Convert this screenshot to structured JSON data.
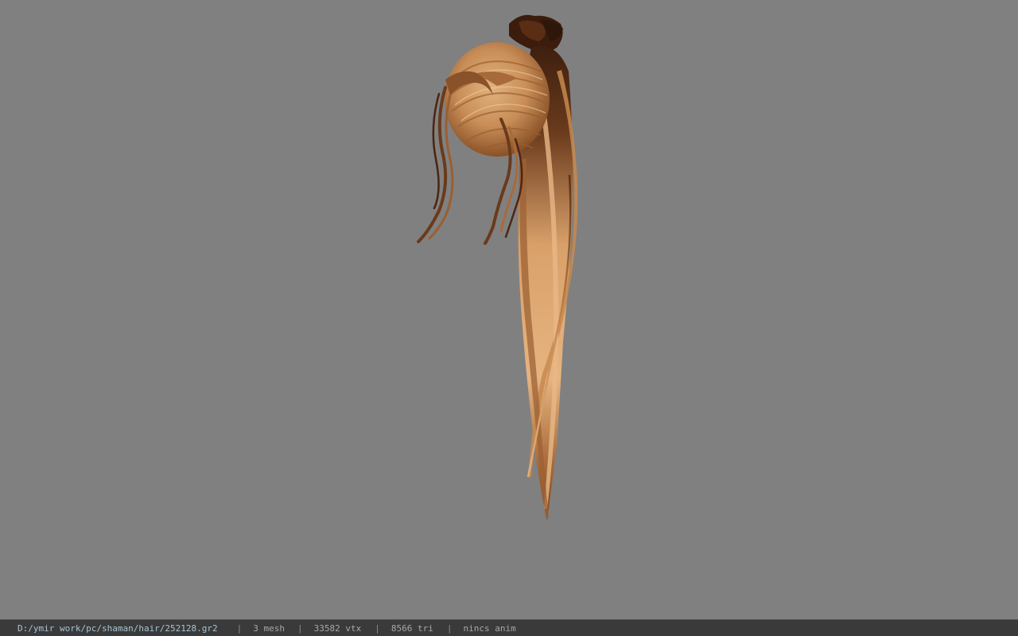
{
  "status_bar": {
    "file_path": "D:/ymir work/pc/shaman/hair/252128.gr2",
    "separator": "|",
    "mesh_count": "3 mesh",
    "vertex_count": "33582 vtx",
    "triangle_count": "8566 tri",
    "animation_status": "nincs anim"
  },
  "colors": {
    "viewport_background": "#808080",
    "status_bar_background": "#3a3a3a",
    "status_text": "#a8a8a8",
    "path_text": "#a9c3d4",
    "hair_dark": "#3e1f10",
    "hair_mid": "#a66a3c",
    "hair_light": "#e3b07c"
  },
  "model": {
    "name": "hair-model",
    "description_icon": "ponytail-hair-mesh-icon"
  }
}
